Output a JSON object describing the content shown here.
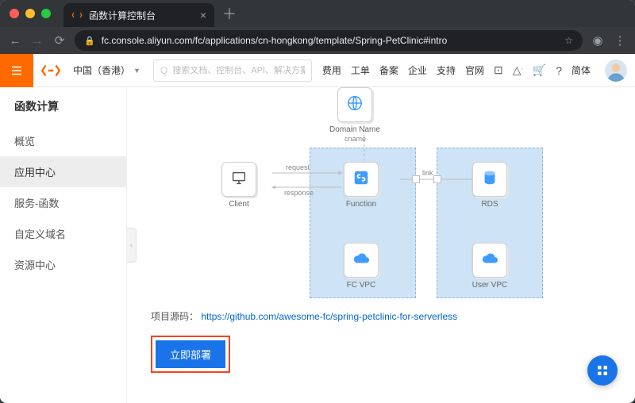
{
  "browser": {
    "tab_title": "函数计算控制台",
    "url": "fc.console.aliyun.com/fc/applications/cn-hongkong/template/Spring-PetClinic#intro"
  },
  "header": {
    "region": "中国（香港）",
    "search_placeholder": "搜索文档、控制台、API、解决方案和资源",
    "links": [
      "费用",
      "工单",
      "备案",
      "企业",
      "支持",
      "官网"
    ],
    "lang": "简体"
  },
  "sidebar": {
    "title": "函数计算",
    "items": [
      {
        "label": "概览"
      },
      {
        "label": "应用中心",
        "active": true
      },
      {
        "label": "服务-函数"
      },
      {
        "label": "自定义域名"
      },
      {
        "label": "资源中心"
      }
    ]
  },
  "diagram": {
    "nodes": {
      "domain": "Domain Name",
      "client": "Client",
      "function": "Function",
      "fc_vpc": "FC VPC",
      "rds": "RDS",
      "user_vpc": "User VPC"
    },
    "edge_labels": {
      "cname": "cname",
      "request": "request",
      "response": "response",
      "link": "link"
    }
  },
  "source": {
    "label": "项目源码：",
    "url_text": "https://github.com/awesome-fc/spring-petclinic-for-serverless"
  },
  "actions": {
    "deploy": "立即部署"
  }
}
